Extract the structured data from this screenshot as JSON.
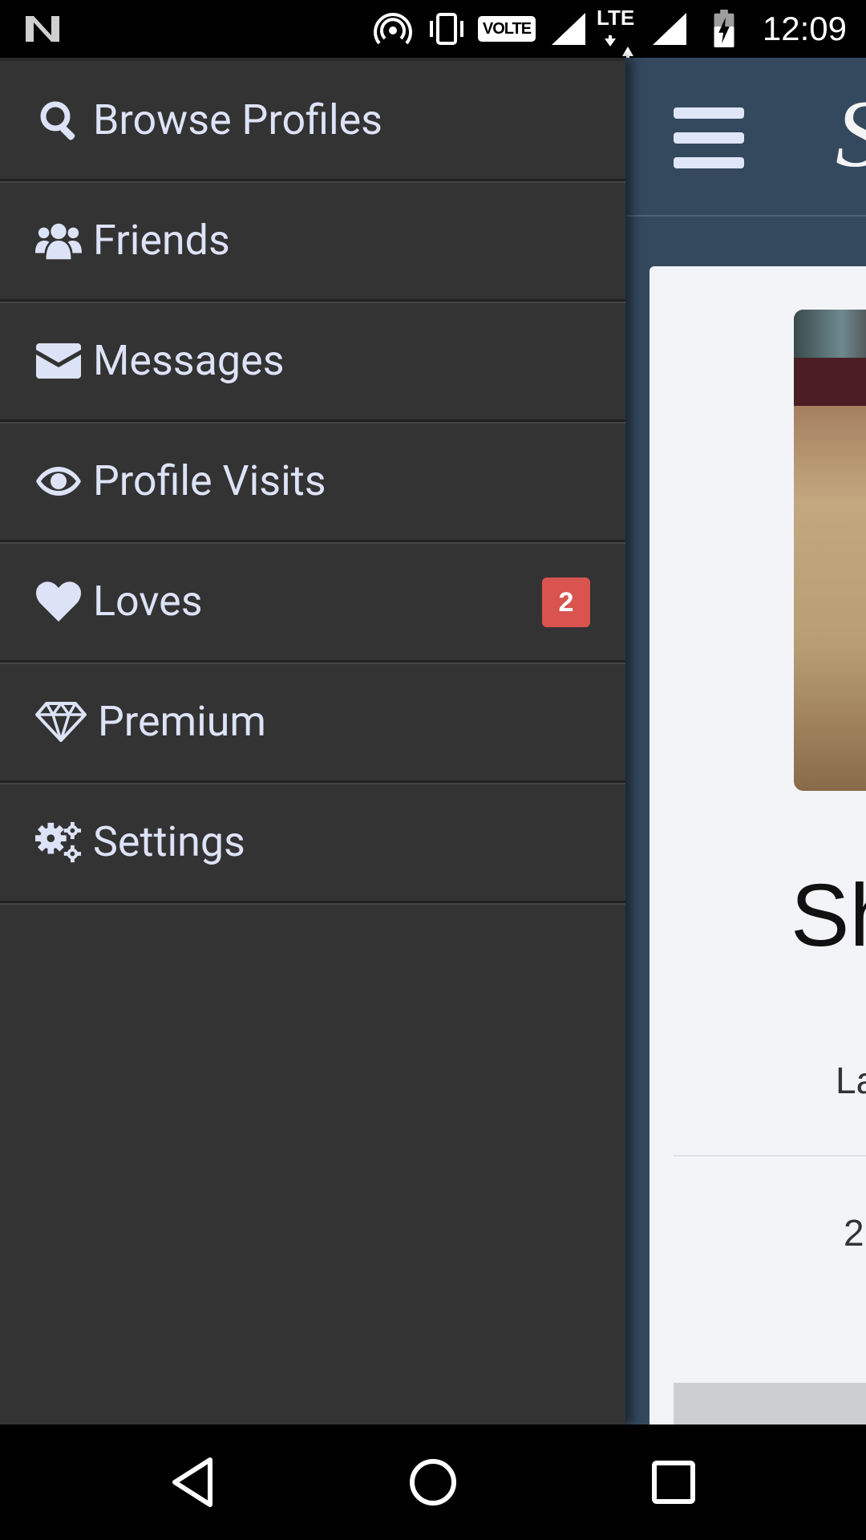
{
  "status_bar": {
    "time": "12:09",
    "volte": "VOLTE",
    "network": "LTE"
  },
  "app": {
    "logo_initial": "S",
    "profile_name_partial": "Sh",
    "location_partial": "La",
    "age_partial": "2"
  },
  "drawer": {
    "items": [
      {
        "label": "Browse Profiles",
        "icon": "search-icon"
      },
      {
        "label": "Friends",
        "icon": "users-icon"
      },
      {
        "label": "Messages",
        "icon": "envelope-icon"
      },
      {
        "label": "Profile Visits",
        "icon": "eye-icon"
      },
      {
        "label": "Loves",
        "icon": "heart-icon",
        "badge": "2"
      },
      {
        "label": "Premium",
        "icon": "diamond-icon"
      },
      {
        "label": "Settings",
        "icon": "cogs-icon"
      }
    ]
  },
  "colors": {
    "drawer_bg": "#333333",
    "menu_text": "#dde3f7",
    "app_header": "#34495e",
    "badge": "#d9534f"
  }
}
